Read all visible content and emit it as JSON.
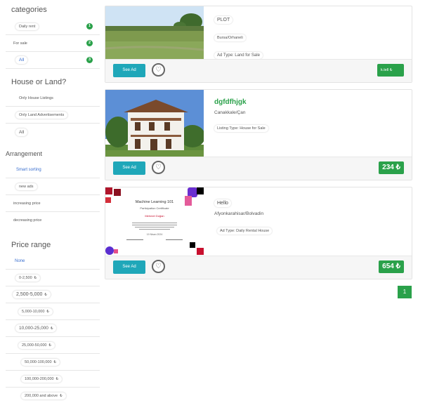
{
  "sidebar": {
    "categories_title": "categories",
    "categories": [
      {
        "label": "Daily rent",
        "count": "1"
      },
      {
        "label": "For sale",
        "count": "2"
      },
      {
        "label": "All",
        "count": "3"
      }
    ],
    "house_land_title": "House or Land?",
    "house_land": [
      {
        "label": "Only House Listings"
      },
      {
        "label": "Only Land Advertisements"
      },
      {
        "label": "All"
      }
    ],
    "arrangement_title": "Arrangement",
    "arrangement": [
      {
        "label": "Smart sorting"
      },
      {
        "label": "new ads"
      },
      {
        "label": "increasing price"
      },
      {
        "label": "decreasing price"
      }
    ],
    "price_title": "Price range",
    "price_ranges": [
      {
        "label": "None"
      },
      {
        "label": "0-2,500",
        "symbol": "₺"
      },
      {
        "label": "2,500-5,000",
        "symbol": "₺"
      },
      {
        "label": "5,000-10,000",
        "symbol": "₺"
      },
      {
        "label": "10,000-25,000",
        "symbol": "₺"
      },
      {
        "label": "25,000-50,000",
        "symbol": "₺"
      },
      {
        "label": "50,000-100,000",
        "symbol": "₺"
      },
      {
        "label": "100,000-200,000",
        "symbol": "₺"
      },
      {
        "label": "200,000 and above",
        "symbol": "₺"
      }
    ]
  },
  "listings": [
    {
      "title": "PLOT",
      "location": "Bursa/Orhaneli",
      "type": "Ad Type: Land for Sale",
      "see_label": "See Ad",
      "price": "k.tell ₺"
    },
    {
      "title": "dgfdfhjgk",
      "location": "Canakkale/Çan",
      "type": "Listing Type: House for Sale",
      "see_label": "See Ad",
      "price": "234 ₺"
    },
    {
      "title": "Hello",
      "location": "Afyonkarahisar/Bolvadin",
      "type": "Ad Type: Daily Rental House",
      "see_label": "See Ad",
      "price": "654 ₺",
      "certificate": {
        "heading": "Machine Learning 101",
        "subheading": "Participation Certificate",
        "name": "Mehmet Doğan",
        "date": "19 Nisan 2024"
      }
    }
  ],
  "pagination": {
    "current": "1"
  },
  "colors": {
    "accent": "#2aa14a",
    "button": "#1fa7b9"
  }
}
